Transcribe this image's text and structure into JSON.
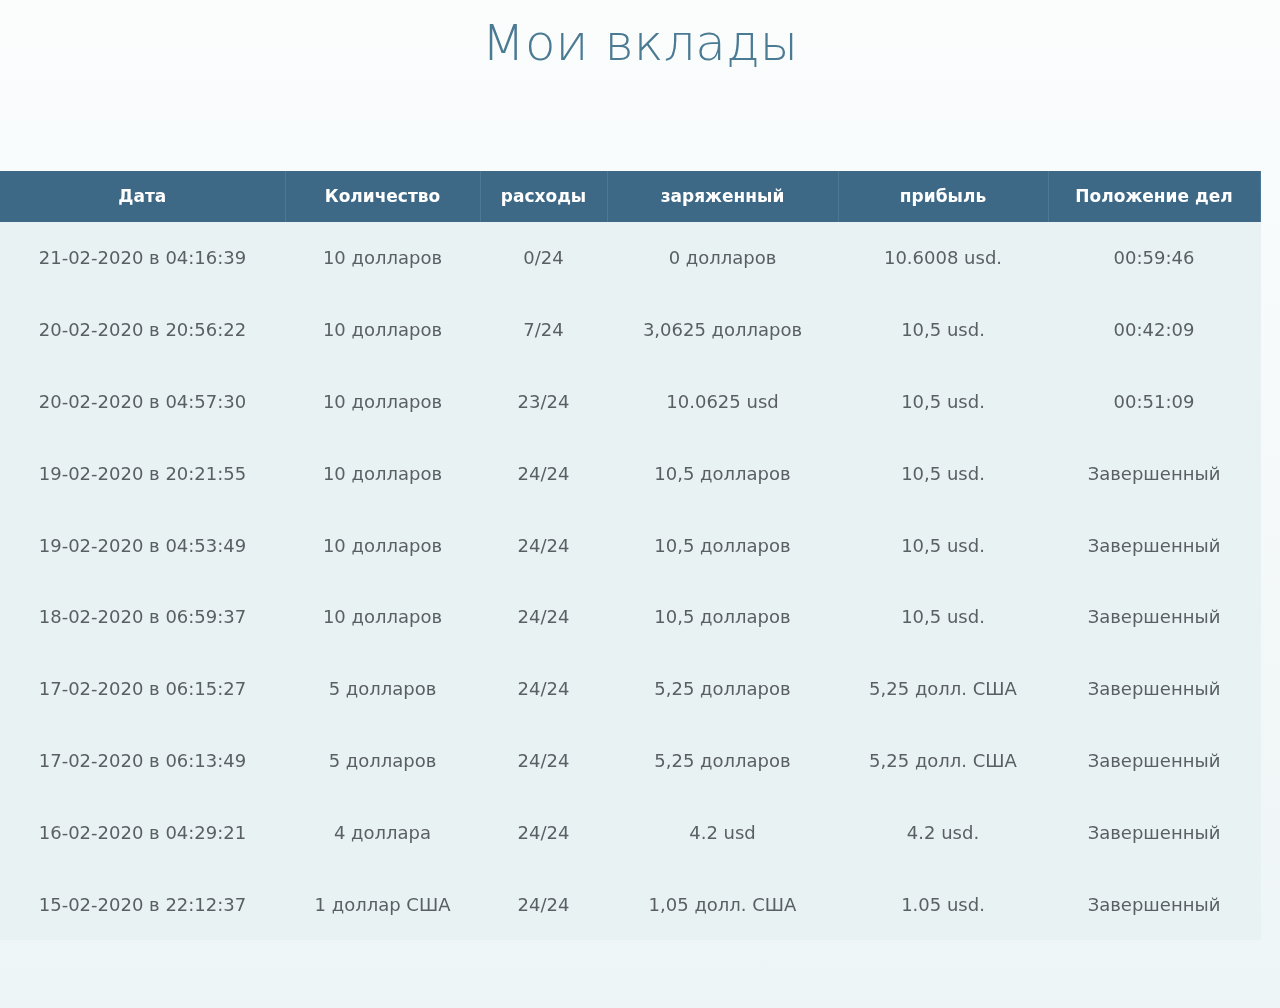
{
  "title": "Мои вклады",
  "table": {
    "columns": [
      "Дата",
      "Количество",
      "расходы",
      "заряженный",
      "прибыль",
      "Положение дел"
    ],
    "rows": [
      [
        "21-02-2020 в 04:16:39",
        "10 долларов",
        "0/24",
        "0 долларов",
        "10.6008 usd.",
        "00:59:46"
      ],
      [
        "20-02-2020 в 20:56:22",
        "10 долларов",
        "7/24",
        "3,0625 долларов",
        "10,5 usd.",
        "00:42:09"
      ],
      [
        "20-02-2020 в 04:57:30",
        "10 долларов",
        "23/24",
        "10.0625 usd",
        "10,5 usd.",
        "00:51:09"
      ],
      [
        "19-02-2020 в 20:21:55",
        "10 долларов",
        "24/24",
        "10,5 долларов",
        "10,5 usd.",
        "Завершенный"
      ],
      [
        "19-02-2020 в 04:53:49",
        "10 долларов",
        "24/24",
        "10,5 долларов",
        "10,5 usd.",
        "Завершенный"
      ],
      [
        "18-02-2020 в 06:59:37",
        "10 долларов",
        "24/24",
        "10,5 долларов",
        "10,5 usd.",
        "Завершенный"
      ],
      [
        "17-02-2020 в 06:15:27",
        "5 долларов",
        "24/24",
        "5,25 долларов",
        "5,25 долл. США",
        "Завершенный"
      ],
      [
        "17-02-2020 в 06:13:49",
        "5 долларов",
        "24/24",
        "5,25 долларов",
        "5,25 долл. США",
        "Завершенный"
      ],
      [
        "16-02-2020 в 04:29:21",
        "4 доллара",
        "24/24",
        "4.2 usd",
        "4.2 usd.",
        "Завершенный"
      ],
      [
        "15-02-2020 в 22:12:37",
        "1 доллар США",
        "24/24",
        "1,05 долл. США",
        "1.05 usd.",
        "Завершенный"
      ]
    ]
  }
}
